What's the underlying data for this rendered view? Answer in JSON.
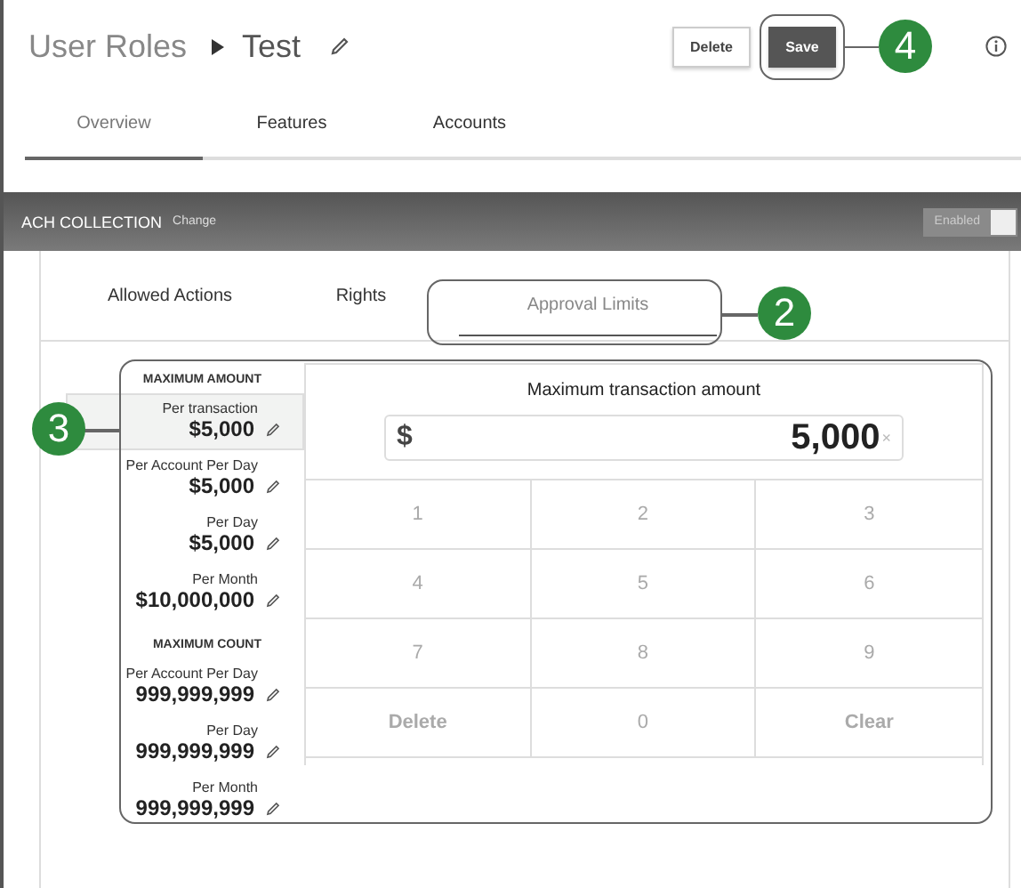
{
  "header": {
    "parent": "User Roles",
    "current": "Test",
    "buttons": [
      {
        "label": "Delete",
        "kind": "secondary"
      },
      {
        "label": "Save",
        "kind": "primary",
        "callout": "4"
      }
    ]
  },
  "tabs": [
    {
      "label": "Overview",
      "selected": true
    },
    {
      "label": "Features",
      "selected": false
    },
    {
      "label": "Accounts",
      "selected": false
    }
  ],
  "section_bar": {
    "title": "ACH COLLECTION",
    "link": "Change",
    "toggle_label": "Enabled"
  },
  "subtabs": [
    {
      "label": "Allowed Actions",
      "selected": false
    },
    {
      "label": "Rights",
      "selected": false
    },
    {
      "label": "Approval Limits",
      "selected": true,
      "callout": "2"
    }
  ],
  "limits": {
    "callout": "3",
    "groups": [
      {
        "heading": "MAXIMUM AMOUNT",
        "items": [
          {
            "label": "Per transaction",
            "value": "$5,000",
            "selected": true
          },
          {
            "label": "Per Account Per Day",
            "value": "$5,000",
            "selected": false
          },
          {
            "label": "Per Day",
            "value": "$5,000",
            "selected": false
          },
          {
            "label": "Per Month",
            "value": "$10,000,000",
            "selected": false
          }
        ]
      },
      {
        "heading": "MAXIMUM COUNT",
        "items": [
          {
            "label": "Per Account Per Day",
            "value": "999,999,999",
            "selected": false
          },
          {
            "label": "Per Day",
            "value": "999,999,999",
            "selected": false
          },
          {
            "label": "Per Month",
            "value": "999,999,999",
            "selected": false
          }
        ]
      }
    ],
    "editor": {
      "title": "Maximum transaction amount",
      "currency": "$",
      "value": "5,000",
      "clear_symbol": "×",
      "keys": [
        "1",
        "2",
        "3",
        "4",
        "5",
        "6",
        "7",
        "8",
        "9",
        "Delete",
        "0",
        "Clear"
      ]
    }
  }
}
